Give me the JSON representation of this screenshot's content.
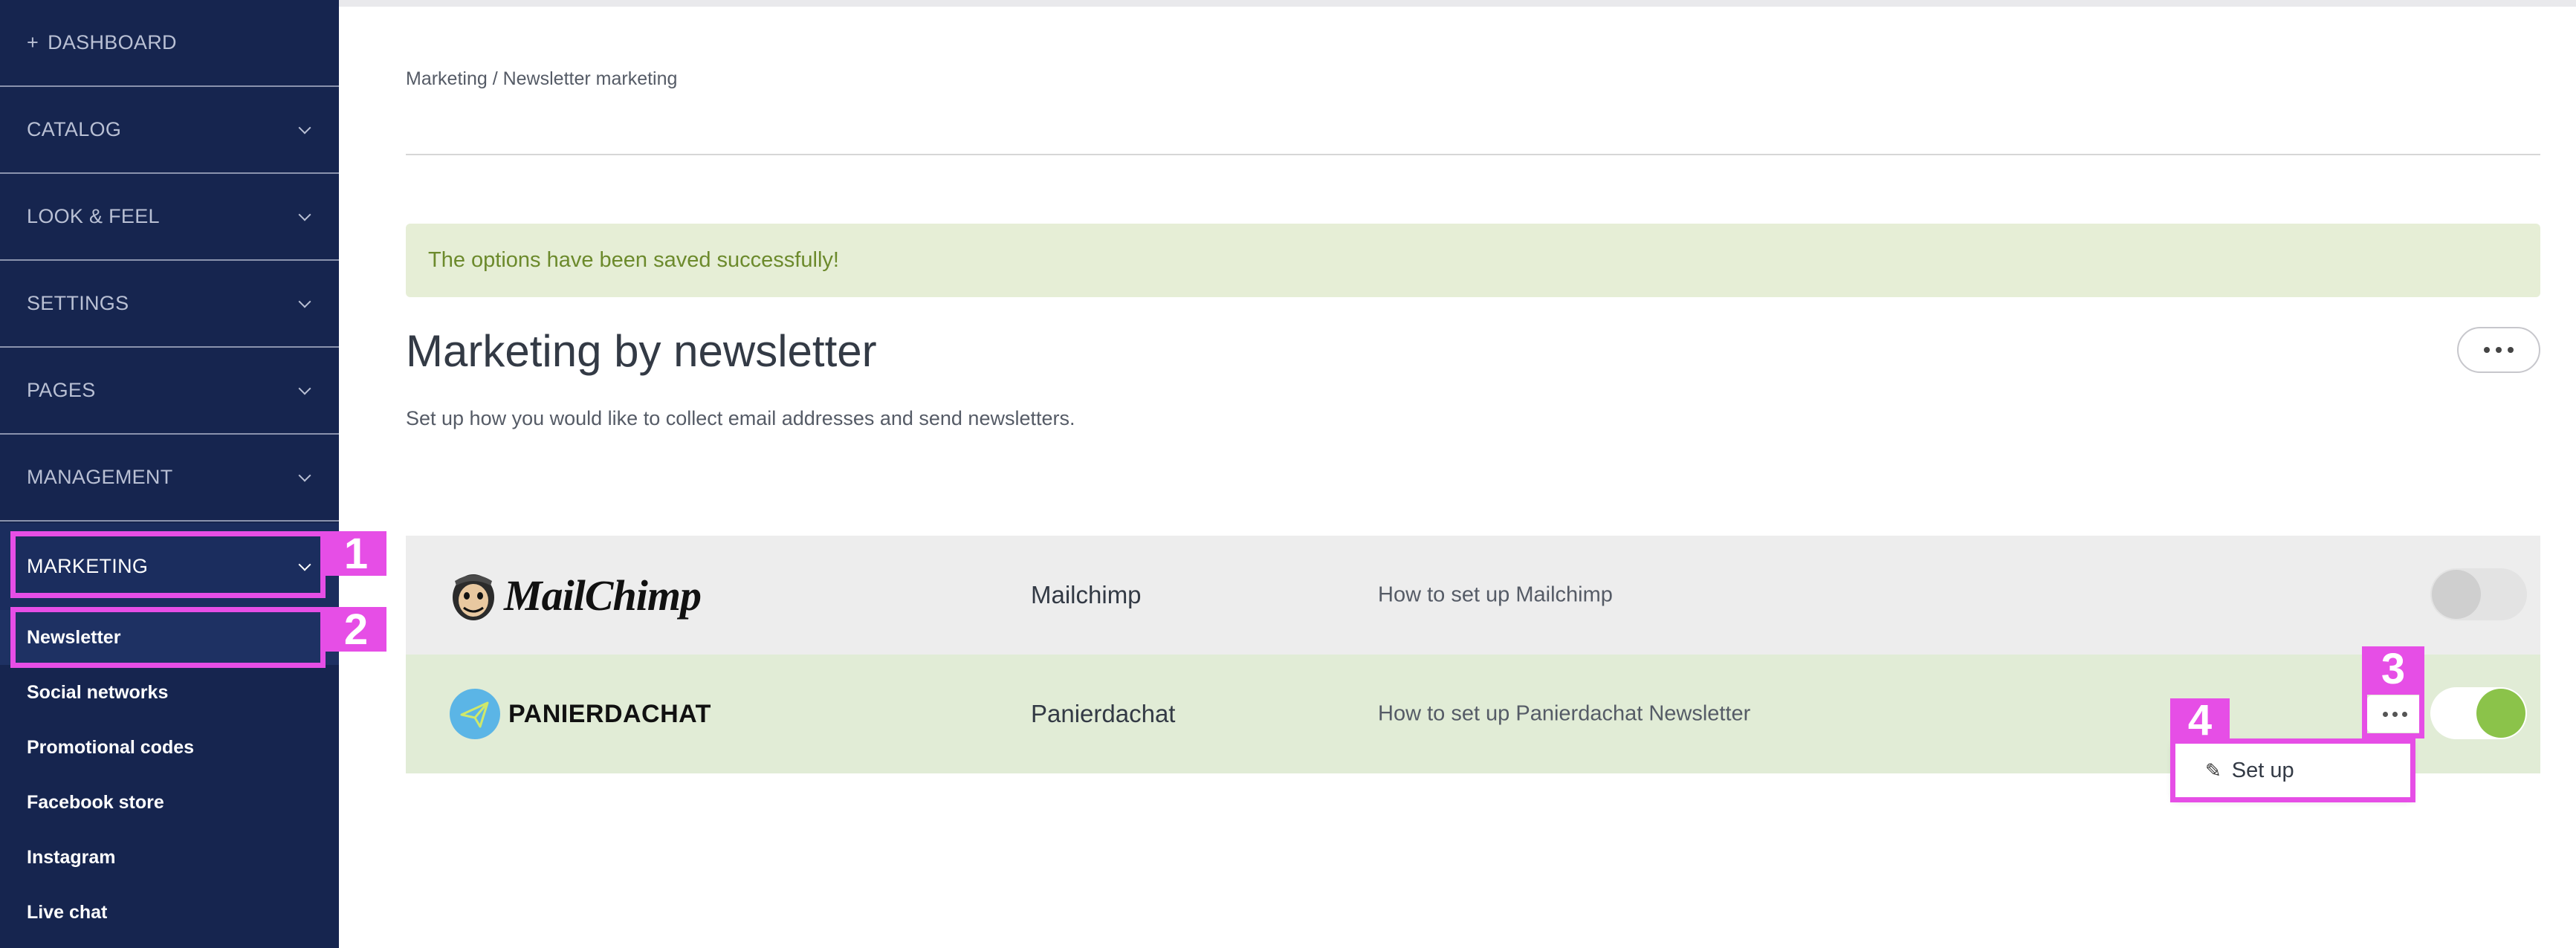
{
  "sidebar": {
    "dashboard": "DASHBOARD",
    "dashboard_prefix": "+",
    "sections": [
      {
        "label": "CATALOG"
      },
      {
        "label": "LOOK & FEEL"
      },
      {
        "label": "SETTINGS"
      },
      {
        "label": "PAGES"
      },
      {
        "label": "MANAGEMENT"
      },
      {
        "label": "MARKETING"
      }
    ],
    "marketing_items": [
      {
        "label": "Newsletter"
      },
      {
        "label": "Social networks"
      },
      {
        "label": "Promotional codes"
      },
      {
        "label": "Facebook store"
      },
      {
        "label": "Instagram"
      },
      {
        "label": "Live chat"
      }
    ]
  },
  "breadcrumb": "Marketing / Newsletter marketing",
  "alert": "The options have been saved successfully!",
  "page": {
    "title": "Marketing by newsletter",
    "description": "Set up how you would like to collect email addresses and send newsletters."
  },
  "providers": [
    {
      "logo_text": "MailChimp",
      "name": "Mailchimp",
      "help_link": "How to set up Mailchimp",
      "enabled": false
    },
    {
      "logo_text": "PANIERDACHAT",
      "name": "Panierdachat",
      "help_link": "How to set up Panierdachat Newsletter",
      "enabled": true
    }
  ],
  "dropdown": {
    "setup_label": "Set up"
  },
  "annotations": [
    "1",
    "2",
    "3",
    "4"
  ],
  "colors": {
    "sidebar_bg": "#16254f",
    "annotation": "#e64ee6",
    "toggle_on": "#8bc34a",
    "alert_bg": "#e6eed6"
  }
}
